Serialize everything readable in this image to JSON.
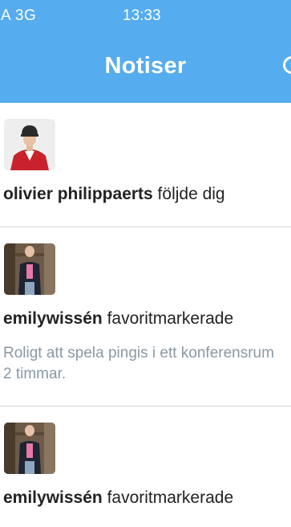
{
  "status_bar": {
    "carrier": "A 3G",
    "time": "13:33"
  },
  "nav": {
    "title": "Notiser"
  },
  "notifications": [
    {
      "user": "olivier philippaerts",
      "action": " följde dig",
      "avatar": "rider-in-red-jacket-photo"
    },
    {
      "user": "emilywissén",
      "action": " favoritmarkerade",
      "tweet_line1": "Roligt att spela pingis i ett konferensrum",
      "tweet_line2": "2 timmar.",
      "avatar": "person-in-dark-jacket-photo"
    },
    {
      "user": "emilywissén",
      "action": " favoritmarkerade",
      "avatar": "person-in-dark-jacket-photo"
    }
  ]
}
